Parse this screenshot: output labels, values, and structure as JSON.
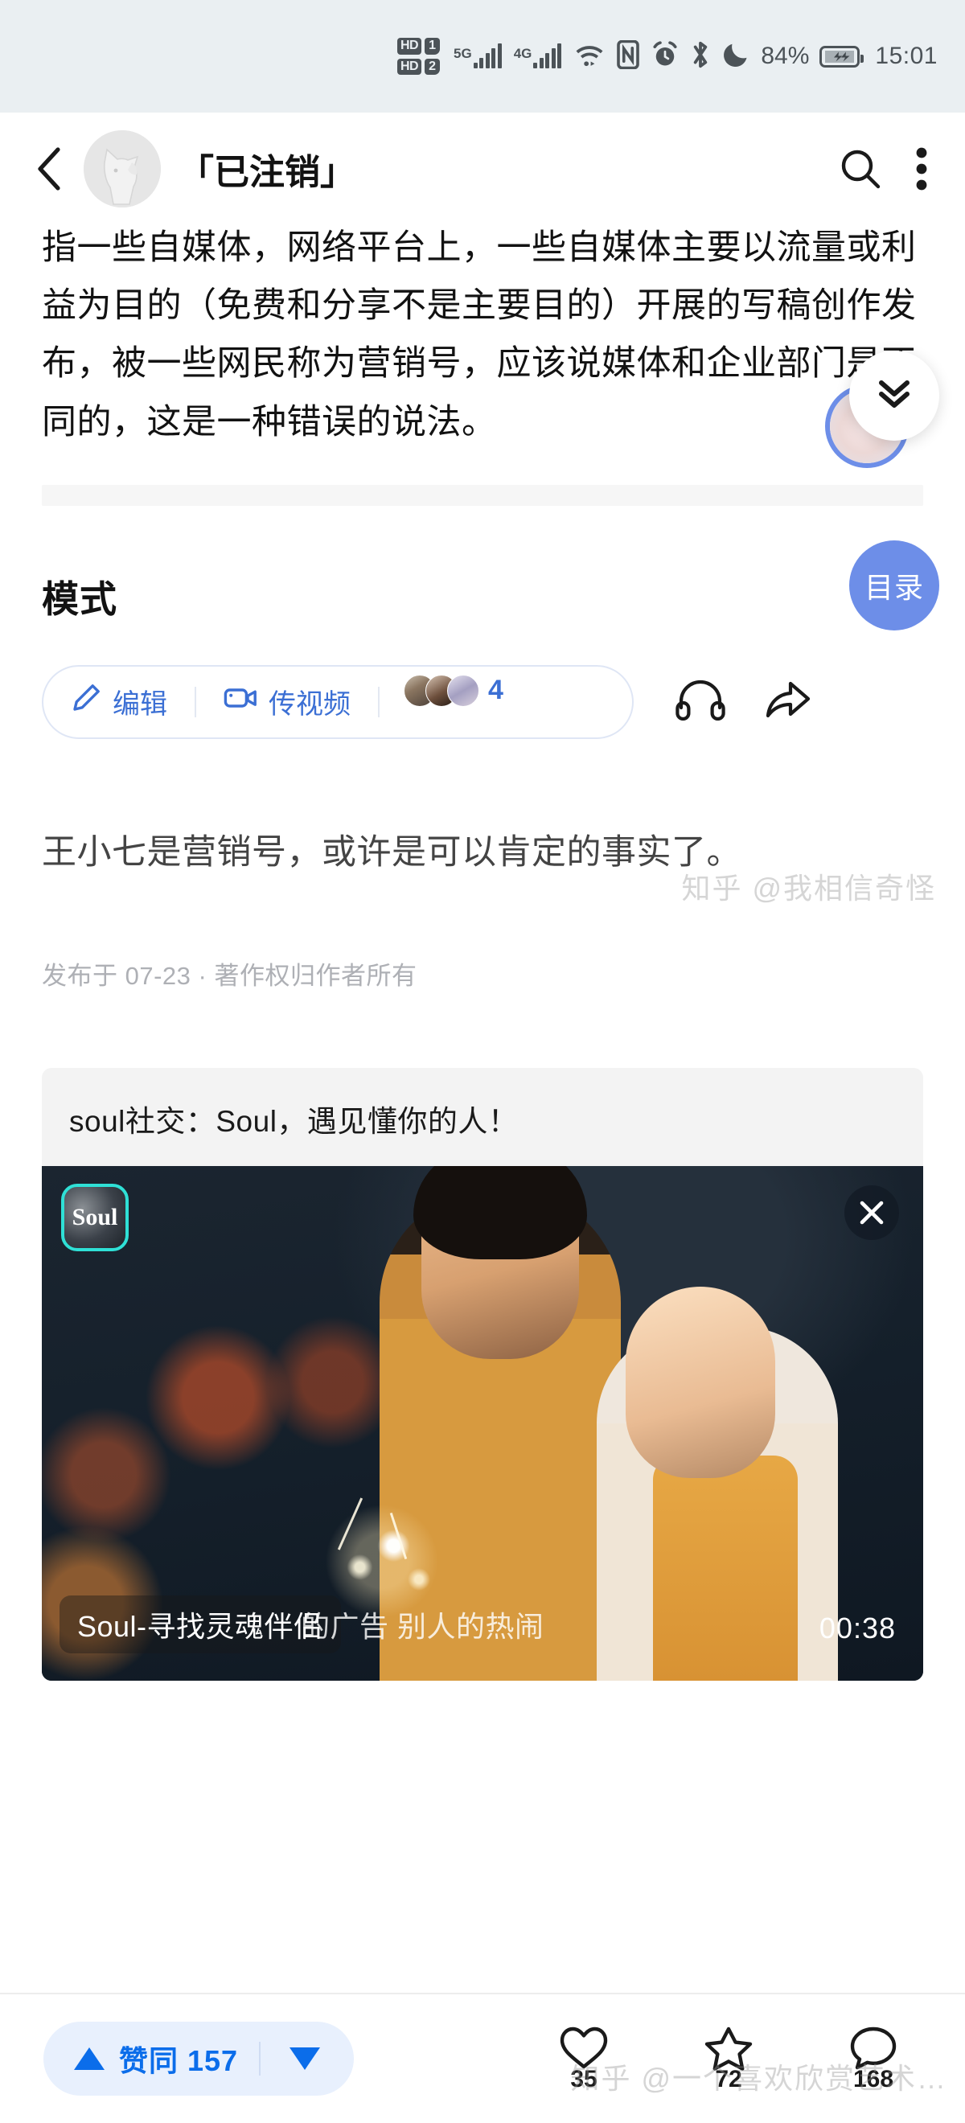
{
  "status_bar": {
    "hd1": "HD",
    "sim1": "1",
    "hd2": "HD",
    "sim2": "2",
    "net1": "5G",
    "net2": "4G",
    "battery_percent": "84%",
    "time": "15:01",
    "icons": [
      "nfc-icon",
      "alarm-icon",
      "bluetooth-icon",
      "do-not-disturb-moon-icon",
      "battery-charging-icon"
    ]
  },
  "nav": {
    "back_icon": "chevron-left-icon",
    "avatar": "default-user-avatar",
    "title": "「已注销」",
    "search_icon": "search-icon",
    "more_icon": "more-vertical-icon"
  },
  "article": {
    "paragraph_top": "指一些自媒体，网络平台上，一些自媒体主要以流量或利益为目的（免费和分享不是主要目的）开展的写稿创作发布，被一些网民称为营销号，应该说媒体和企业部门是不同的，这是一种错误的说法。",
    "section_title": "模式",
    "listen_icon": "headphones-icon",
    "paragraph_main": "王小七是营销号，或许是可以肯定的事实了。",
    "publish_info": "发布于 07-23 · 著作权归作者所有"
  },
  "action_bar": {
    "edit_label": "编辑",
    "edit_icon": "pencil-icon",
    "video_label": "传视频",
    "video_icon": "video-camera-icon",
    "contributor_count": "4",
    "listen_icon": "headphones-icon",
    "share_icon": "share-arrow-icon"
  },
  "floating": {
    "collapse_icon": "double-chevron-down-icon",
    "catalog_label": "目录"
  },
  "ad": {
    "title": "soul社交：Soul，遇见懂你的人！",
    "logo_text": "Soul",
    "close_icon": "close-x-icon",
    "caption": "Soul-寻找灵魂伴侣",
    "caption_overlap": "的广告 别人的热闹",
    "duration": "00:38"
  },
  "bottom_bar": {
    "vote_up_icon": "triangle-up-icon",
    "vote_label": "赞同 157",
    "vote_down_icon": "triangle-down-icon",
    "actions": [
      {
        "icon": "heart-icon",
        "count": "35"
      },
      {
        "icon": "star-icon",
        "count": "72"
      },
      {
        "icon": "comment-icon",
        "count": "168"
      }
    ]
  },
  "watermarks": {
    "top": "知乎 @我相信奇怪",
    "bottom": "知乎 @一个喜欢欣赏艺术…"
  }
}
